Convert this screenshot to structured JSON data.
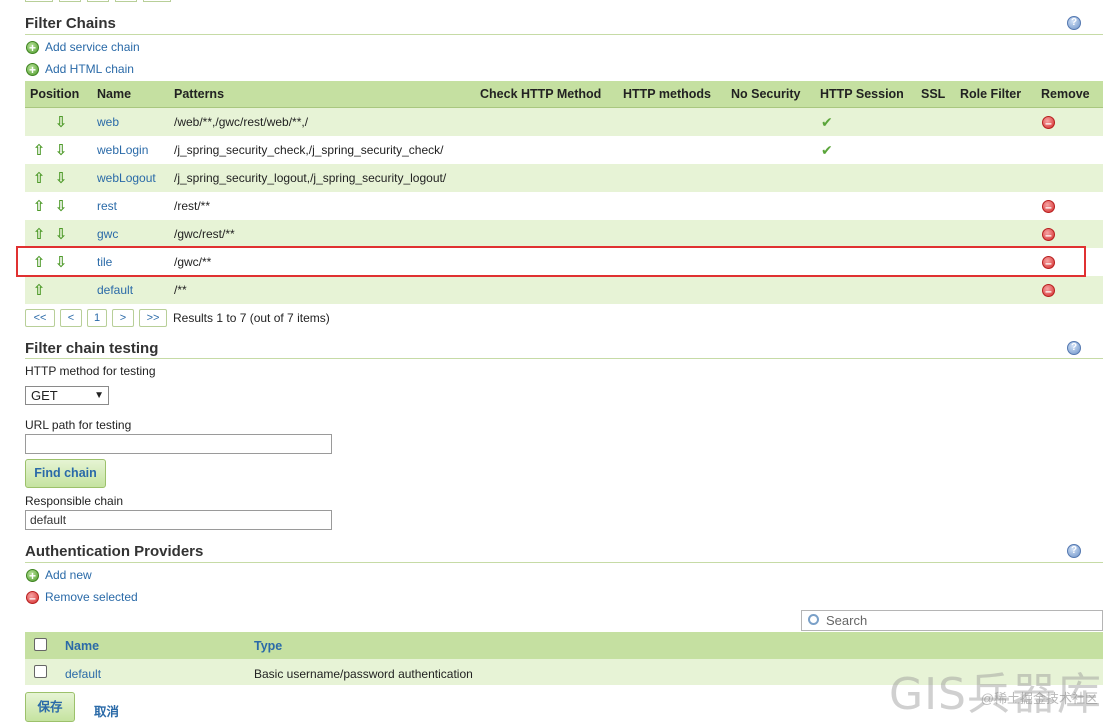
{
  "filter_chains": {
    "title": "Filter Chains",
    "help": "?",
    "add_service_chain": "Add service chain",
    "add_html_chain": "Add HTML chain",
    "columns": [
      "Position",
      "Name",
      "Patterns",
      "Check HTTP Method",
      "HTTP methods",
      "No Security",
      "HTTP Session",
      "SSL",
      "Role Filter",
      "Remove"
    ],
    "rows": [
      {
        "up": false,
        "down": true,
        "name": "web",
        "patterns": "/web/**,/gwc/rest/web/**,/",
        "http_session": true,
        "remove": true
      },
      {
        "up": true,
        "down": true,
        "name": "webLogin",
        "patterns": "/j_spring_security_check,/j_spring_security_check/",
        "http_session": true,
        "remove": false
      },
      {
        "up": true,
        "down": true,
        "name": "webLogout",
        "patterns": "/j_spring_security_logout,/j_spring_security_logout/",
        "http_session": false,
        "remove": false
      },
      {
        "up": true,
        "down": true,
        "name": "rest",
        "patterns": "/rest/**",
        "http_session": false,
        "remove": true
      },
      {
        "up": true,
        "down": true,
        "name": "gwc",
        "patterns": "/gwc/rest/**",
        "http_session": false,
        "remove": true
      },
      {
        "up": true,
        "down": true,
        "name": "tile",
        "patterns": "/gwc/**",
        "http_session": false,
        "remove": true
      },
      {
        "up": true,
        "down": false,
        "name": "default",
        "patterns": "/**",
        "http_session": false,
        "remove": true
      }
    ],
    "pager": {
      "first": "<<",
      "prev": "<",
      "page": "1",
      "next": ">",
      "last": ">>",
      "results": "Results 1 to 7 (out of 7 items)"
    }
  },
  "testing": {
    "title": "Filter chain testing",
    "help": "?",
    "method_label": "HTTP method for testing",
    "method_value": "GET",
    "url_label": "URL path for testing",
    "url_value": "",
    "find_button": "Find chain",
    "responsible_label": "Responsible chain",
    "responsible_value": "default"
  },
  "auth": {
    "title": "Authentication Providers",
    "help": "?",
    "add_new": "Add new",
    "remove_selected": "Remove selected",
    "search_placeholder": "Search",
    "columns": {
      "name": "Name",
      "type": "Type"
    },
    "rows": [
      {
        "name": "default",
        "type": "Basic username/password authentication"
      }
    ]
  },
  "footer": {
    "save": "保存",
    "cancel": "取消"
  },
  "watermark": {
    "main": "GIS兵器库",
    "sub": "@稀土掘金技术社区"
  },
  "icons": {
    "up": "arrow-up-icon",
    "down": "arrow-down-icon",
    "check": "check-icon",
    "remove": "remove-icon",
    "add": "add-icon",
    "help": "help-icon",
    "search": "search-icon"
  },
  "colors": {
    "header_bg": "#c5e0a1",
    "row_alt_bg": "#e7f3d6",
    "link": "#2a6aa8",
    "highlight": "#e03131"
  }
}
